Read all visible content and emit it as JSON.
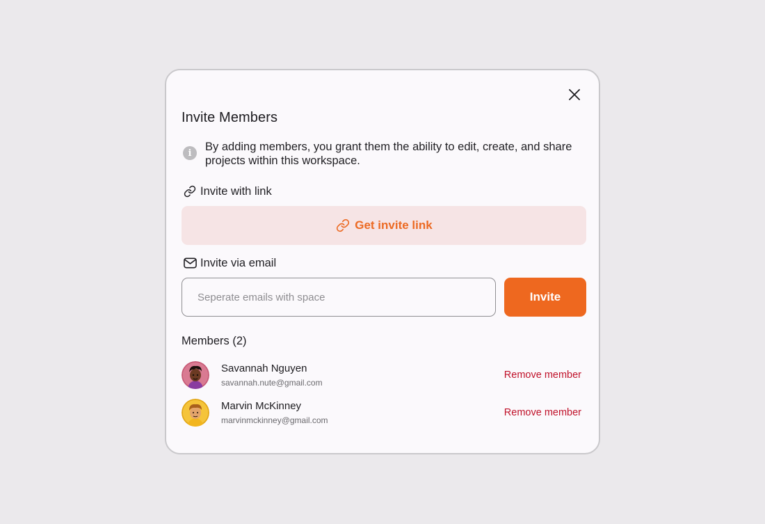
{
  "modal": {
    "title": "Invite Members",
    "info_text": "By adding members, you grant them the ability to edit, create, and share projects within this workspace.",
    "link_section_label": "Invite with link",
    "get_link_button": "Get invite link",
    "email_section_label": "Invite via email",
    "email_input": {
      "placeholder": "Seperate emails with space",
      "value": ""
    },
    "invite_button": "Invite",
    "members_title": "Members (2)",
    "members": [
      {
        "name": "Savannah Nguyen",
        "email": "savannah.nute@gmail.com",
        "action": "Remove member"
      },
      {
        "name": "Marvin McKinney",
        "email": "marvinmckinney@gmail.com",
        "action": "Remove member"
      }
    ]
  },
  "icons": {
    "close": "close-icon",
    "info": "info-icon",
    "link": "link-icon",
    "mail": "mail-icon"
  },
  "colors": {
    "accent": "#ee681f",
    "accent_soft_bg": "#f6e4e5",
    "danger": "#c0122a",
    "background": "#ebe9ec",
    "surface": "#fbf9fc"
  }
}
